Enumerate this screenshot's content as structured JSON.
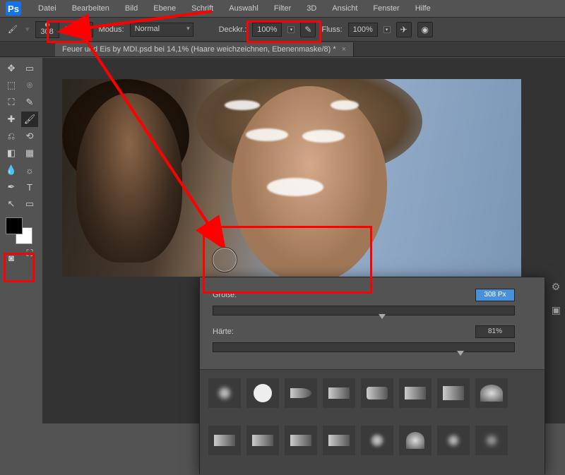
{
  "app": {
    "logo": "Ps"
  },
  "menu": [
    "Datei",
    "Bearbeiten",
    "Bild",
    "Ebene",
    "Schrift",
    "Auswahl",
    "Filter",
    "3D",
    "Ansicht",
    "Fenster",
    "Hilfe"
  ],
  "options": {
    "brush_size": "308",
    "mode_label": "Modus:",
    "mode_value": "Normal",
    "opacity_label": "Deckkr.:",
    "opacity_value": "100%",
    "flow_label": "Fluss:",
    "flow_value": "100%"
  },
  "tab": {
    "title": "Feuer und Eis by MDI.psd bei 14,1% (Haare weichzeichnen, Ebenenmaske/8) *"
  },
  "brush_panel": {
    "size_label": "Größe:",
    "size_value": "308 Px",
    "hardness_label": "Härte:",
    "hardness_value": "81%"
  }
}
